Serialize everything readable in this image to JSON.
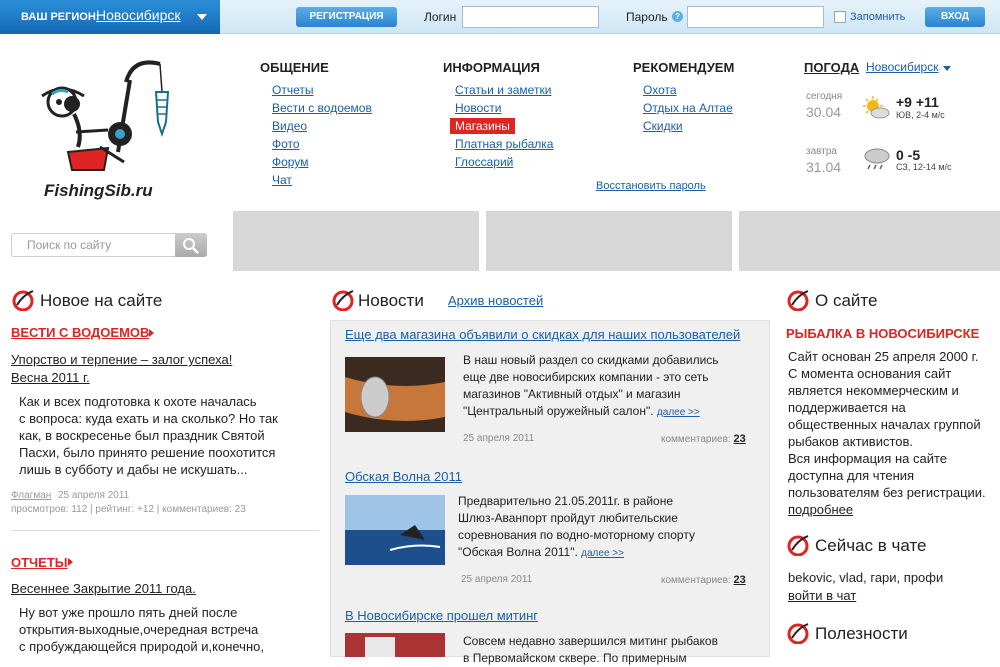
{
  "topbar": {
    "region_label": "ВАШ РЕГИОН:",
    "region_city": "Новосибирск",
    "register_label": "РЕГИСТРАЦИЯ",
    "login_label": "Логин",
    "password_label": "Пароль",
    "help_glyph": "?",
    "remember_label": "Запомнить",
    "enter_label": "ВХОД"
  },
  "logo": {
    "text": "FishingSib.ru"
  },
  "nav": {
    "obshchenie": {
      "title": "ОБЩЕНИЕ",
      "items": [
        "Отчеты",
        "Вести с водоемов",
        "Видео",
        "Фото",
        "Форум",
        "Чат"
      ]
    },
    "informatsiya": {
      "title": "ИНФОРМАЦИЯ",
      "items": [
        "Статьи и заметки",
        "Новости",
        "Магазины",
        "Платная рыбалка",
        "Глоссарий"
      ]
    },
    "rekomenduem": {
      "title": "РЕКОМЕНДУЕМ",
      "items": [
        "Охота",
        "Отдых на Алтае",
        "Скидки"
      ]
    },
    "restore_password": "Восстановить пароль"
  },
  "weather": {
    "title": "ПОГОДА",
    "city": "Новосибирск",
    "today": {
      "label": "сегодня",
      "date": "30.04",
      "temp": "+9 +11",
      "wind": "ЮВ, 2-4 м/с"
    },
    "tomorrow": {
      "label": "завтра",
      "date": "31.04",
      "temp": "0 -5",
      "wind": "СЗ, 12-14 м/с"
    }
  },
  "search": {
    "placeholder": "Поиск по сайту"
  },
  "left": {
    "title": "Новое на сайте",
    "block1": {
      "category": "ВЕСТИ С ВОДОЕМОВ",
      "link": "Упорство и терпение – залог успеха!",
      "link2": "Весна 2011 г.",
      "text": [
        "Как и всех подготовка к охоте началась",
        "с вопроса: куда ехать и на сколько? Но так",
        "как, в воскресенье был праздник Святой",
        "Пасхи, было принято решение поохотится",
        "лишь в субботу и дабы не искушать..."
      ],
      "author": "Флагман",
      "date": "25 апреля 2011",
      "stats": "просмотров: 112 | рейтинг: +12 | комментариев: 23"
    },
    "block2": {
      "category": "ОТЧЕТЫ",
      "link": "Весеннее Закрытие 2011 года.",
      "text": [
        "Ну вот уже прошло пять дней после",
        "открытия-выходные,очередная встреча",
        "с пробуждающейся природой и,конечно,"
      ]
    }
  },
  "news": {
    "title": "Новости",
    "archive": "Архив новостей",
    "items": [
      {
        "title": "Еще два магазина объявили о скидках для наших пользователей",
        "text": [
          "В наш новый раздел со скидками добавились",
          "еще две новосибирских компании - это сеть",
          "магазинов \"Активный отдых\" и магазин",
          "\"Центральный оружейный салон\"."
        ],
        "more": "далее >>",
        "date": "25 апреля 2011",
        "comments_label": "комментариев:",
        "comments": "23"
      },
      {
        "title": "Обская Волна 2011",
        "text": [
          "Предварительно 21.05.2011г. в районе",
          "Шлюз-Аванпорт пройдут любительские",
          "соревнования по водно-моторному спорту",
          "\"Обская Волна 2011\"."
        ],
        "more": "далее >>",
        "date": "25 апреля 2011",
        "comments_label": "комментариев:",
        "comments": "23"
      },
      {
        "title": "В Новосибирске прошел митинг",
        "text": [
          "Совсем недавно завершился митинг рыбаков",
          "в Первомайском сквере. По примерным"
        ]
      }
    ]
  },
  "right": {
    "about_title": "О сайте",
    "about_sub": "РЫБАЛКА В НОВОСИБИРСКЕ",
    "about_text": [
      "Сайт основан 25 апреля 2000 г.",
      "С момента основания сайт",
      "является некоммерческим и",
      "поддерживается на",
      "общественных началах группой",
      "рыбаков активистов.",
      "Вся информация на сайте",
      "доступна для чтения",
      "пользователям без регистрации."
    ],
    "about_more": "подробнее",
    "chat_title": "Сейчас в чате",
    "chat_users": "bekovic, vlad, гари, профи",
    "chat_link": "войти в чат",
    "useful_title": "Полезности"
  },
  "colors": {
    "accent": "#e02323",
    "link": "#1a5fa8",
    "topbar": "#1569b3"
  }
}
